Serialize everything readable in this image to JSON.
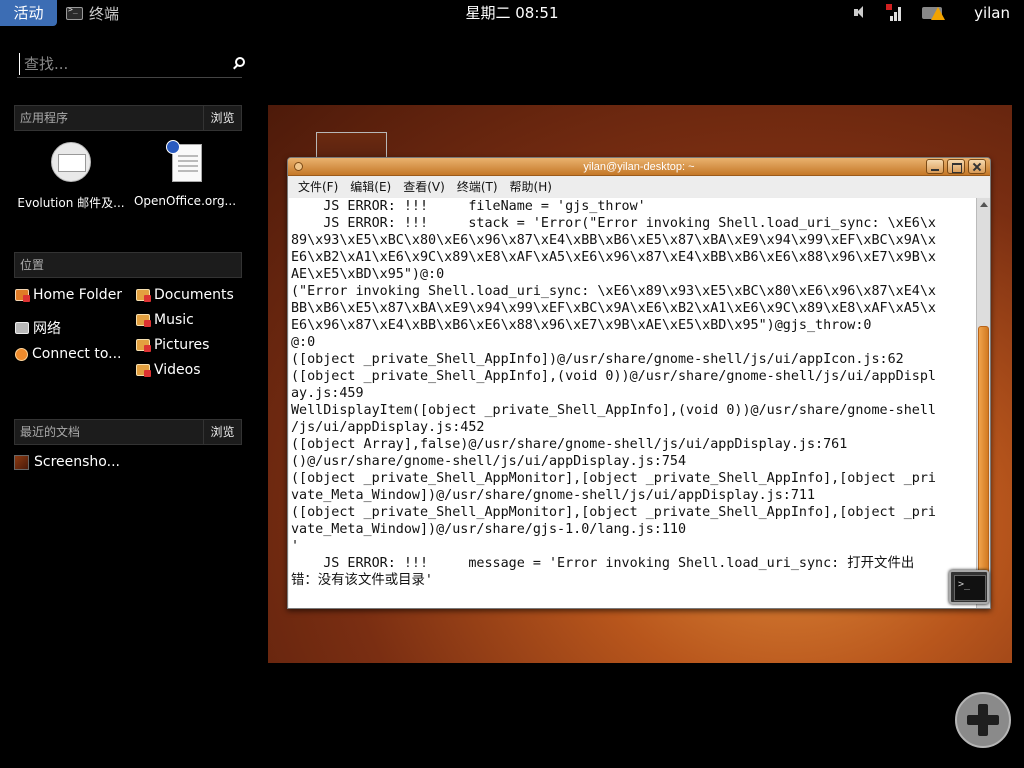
{
  "top_panel": {
    "activities": "活动",
    "app_name": "终端",
    "clock": "星期二 08:51",
    "user": "yilan"
  },
  "search": {
    "placeholder": "查找..."
  },
  "applications": {
    "header": "应用程序",
    "browse": "浏览",
    "items": [
      {
        "label": "Evolution 邮件及...",
        "icon": "mail-icon"
      },
      {
        "label": "OpenOffice.org...",
        "icon": "document-icon"
      }
    ]
  },
  "places": {
    "header": "位置",
    "left_items": [
      {
        "label": "Home Folder",
        "icon": "home-folder-icon"
      },
      {
        "label": "网络",
        "icon": "network-icon"
      },
      {
        "label": "Connect to...",
        "icon": "connect-icon"
      }
    ],
    "right_items": [
      {
        "label": "Documents",
        "icon": "folder-icon"
      },
      {
        "label": "Music",
        "icon": "folder-icon"
      },
      {
        "label": "Pictures",
        "icon": "folder-icon"
      },
      {
        "label": "Videos",
        "icon": "folder-icon"
      }
    ]
  },
  "recent": {
    "header": "最近的文档",
    "browse": "浏览",
    "items": [
      {
        "label": "Screensho...",
        "icon": "image-icon"
      }
    ]
  },
  "terminal": {
    "title": "yilan@yilan-desktop: ~",
    "menu": [
      "文件(F)",
      "编辑(E)",
      "查看(V)",
      "终端(T)",
      "帮助(H)"
    ],
    "lines": [
      "    JS ERROR: !!!     fileName = 'gjs_throw'",
      "    JS ERROR: !!!     stack = 'Error(\"Error invoking Shell.load_uri_sync: \\xE6\\x",
      "89\\x93\\xE5\\xBC\\x80\\xE6\\x96\\x87\\xE4\\xBB\\xB6\\xE5\\x87\\xBA\\xE9\\x94\\x99\\xEF\\xBC\\x9A\\x",
      "E6\\xB2\\xA1\\xE6\\x9C\\x89\\xE8\\xAF\\xA5\\xE6\\x96\\x87\\xE4\\xBB\\xB6\\xE6\\x88\\x96\\xE7\\x9B\\x",
      "AE\\xE5\\xBD\\x95\")@:0",
      "(\"Error invoking Shell.load_uri_sync: \\xE6\\x89\\x93\\xE5\\xBC\\x80\\xE6\\x96\\x87\\xE4\\x",
      "BB\\xB6\\xE5\\x87\\xBA\\xE9\\x94\\x99\\xEF\\xBC\\x9A\\xE6\\xB2\\xA1\\xE6\\x9C\\x89\\xE8\\xAF\\xA5\\x",
      "E6\\x96\\x87\\xE4\\xBB\\xB6\\xE6\\x88\\x96\\xE7\\x9B\\xAE\\xE5\\xBD\\x95\")@gjs_throw:0",
      "@:0",
      "([object _private_Shell_AppInfo])@/usr/share/gnome-shell/js/ui/appIcon.js:62",
      "([object _private_Shell_AppInfo],(void 0))@/usr/share/gnome-shell/js/ui/appDispl",
      "ay.js:459",
      "WellDisplayItem([object _private_Shell_AppInfo],(void 0))@/usr/share/gnome-shell",
      "/js/ui/appDisplay.js:452",
      "([object Array],false)@/usr/share/gnome-shell/js/ui/appDisplay.js:761",
      "()@/usr/share/gnome-shell/js/ui/appDisplay.js:754",
      "([object _private_Shell_AppMonitor],[object _private_Shell_AppInfo],[object _pri",
      "vate_Meta_Window])@/usr/share/gnome-shell/js/ui/appDisplay.js:711",
      "([object _private_Shell_AppMonitor],[object _private_Shell_AppInfo],[object _pri",
      "vate_Meta_Window])@/usr/share/gjs-1.0/lang.js:110",
      "'",
      "    JS ERROR: !!!     message = 'Error invoking Shell.load_uri_sync: 打开文件出",
      "错：没有该文件或目录'"
    ]
  },
  "colors": {
    "activities_bg": "#3c6db4",
    "title_bar": "#c57828",
    "scroll_thumb": "#d27a22"
  }
}
